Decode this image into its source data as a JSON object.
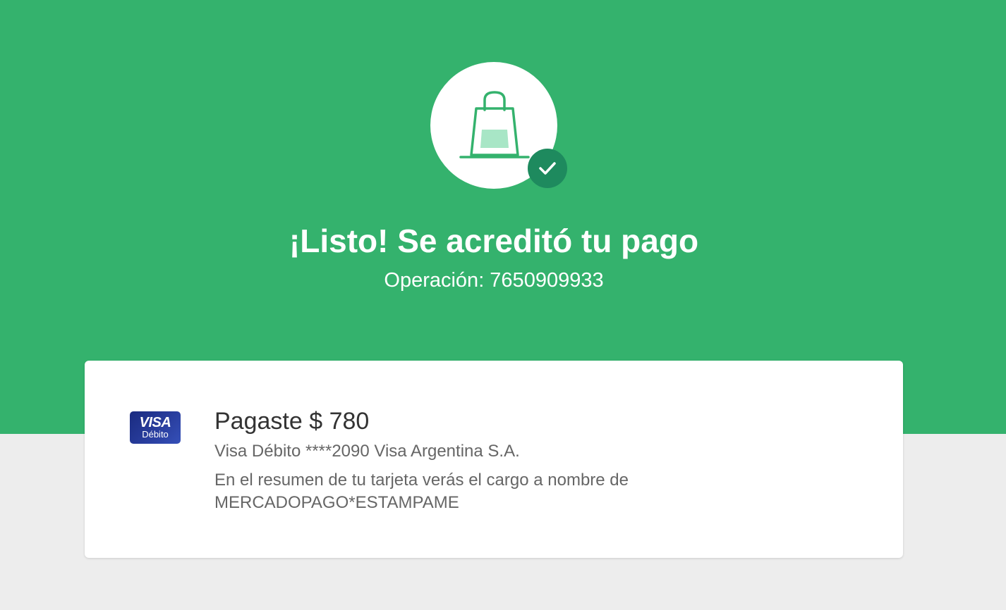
{
  "header": {
    "title": "¡Listo! Se acreditó tu pago",
    "operation_label": "Operación: 7650909933",
    "icon": "shopping-bag-icon",
    "status_icon": "check-icon"
  },
  "payment_card": {
    "card_brand": "VISA",
    "card_type": "Débito",
    "paid_text": "Pagaste $ 780",
    "method_text": "Visa Débito ****2090 Visa Argentina S.A.",
    "statement_line1": "En el resumen de tu tarjeta verás el cargo a nombre de",
    "statement_line2": "MERCADOPAGO*ESTAMPAME"
  },
  "colors": {
    "brand_green": "#34b26d",
    "check_green": "#1e8a5e",
    "background": "#ededed",
    "visa_blue": "#1a2b80"
  }
}
